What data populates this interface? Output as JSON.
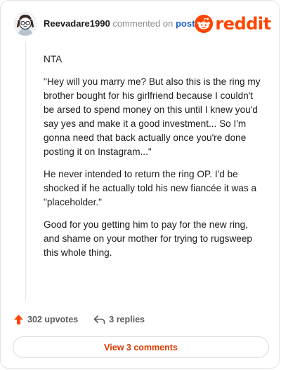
{
  "header": {
    "username": "Reevadare1990",
    "commented_on": "commented on",
    "post_link": "post",
    "logo_text": "reddit"
  },
  "comment": {
    "paragraphs": [
      "NTA",
      "\"Hey will you marry me? But also this is the ring my brother bought for his girlfriend because I couldn't be arsed to spend money on this until I knew you'd say yes and make it a good investment... So I'm gonna need that back actually once you're done posting it on Instagram...\"",
      "He never intended to return the ring OP. I'd be shocked if he actually told his new fiancée it was a \"placeholder.\"",
      "Good for you getting him to pay for the new ring, and shame on your mother for trying to rugsweep this whole thing."
    ]
  },
  "actions": {
    "upvotes": "302 upvotes",
    "replies": "3 replies"
  },
  "view_comments_label": "View 3 comments",
  "colors": {
    "brand": "#ff4500",
    "upvote": "#ff4500",
    "link": "#1d62c9",
    "button_text": "#d93a00"
  },
  "icons": {
    "avatar": "snoo-avatar",
    "logo": "reddit-alien-icon",
    "upvote": "upvote-arrow-icon",
    "reply": "reply-arrow-icon"
  }
}
